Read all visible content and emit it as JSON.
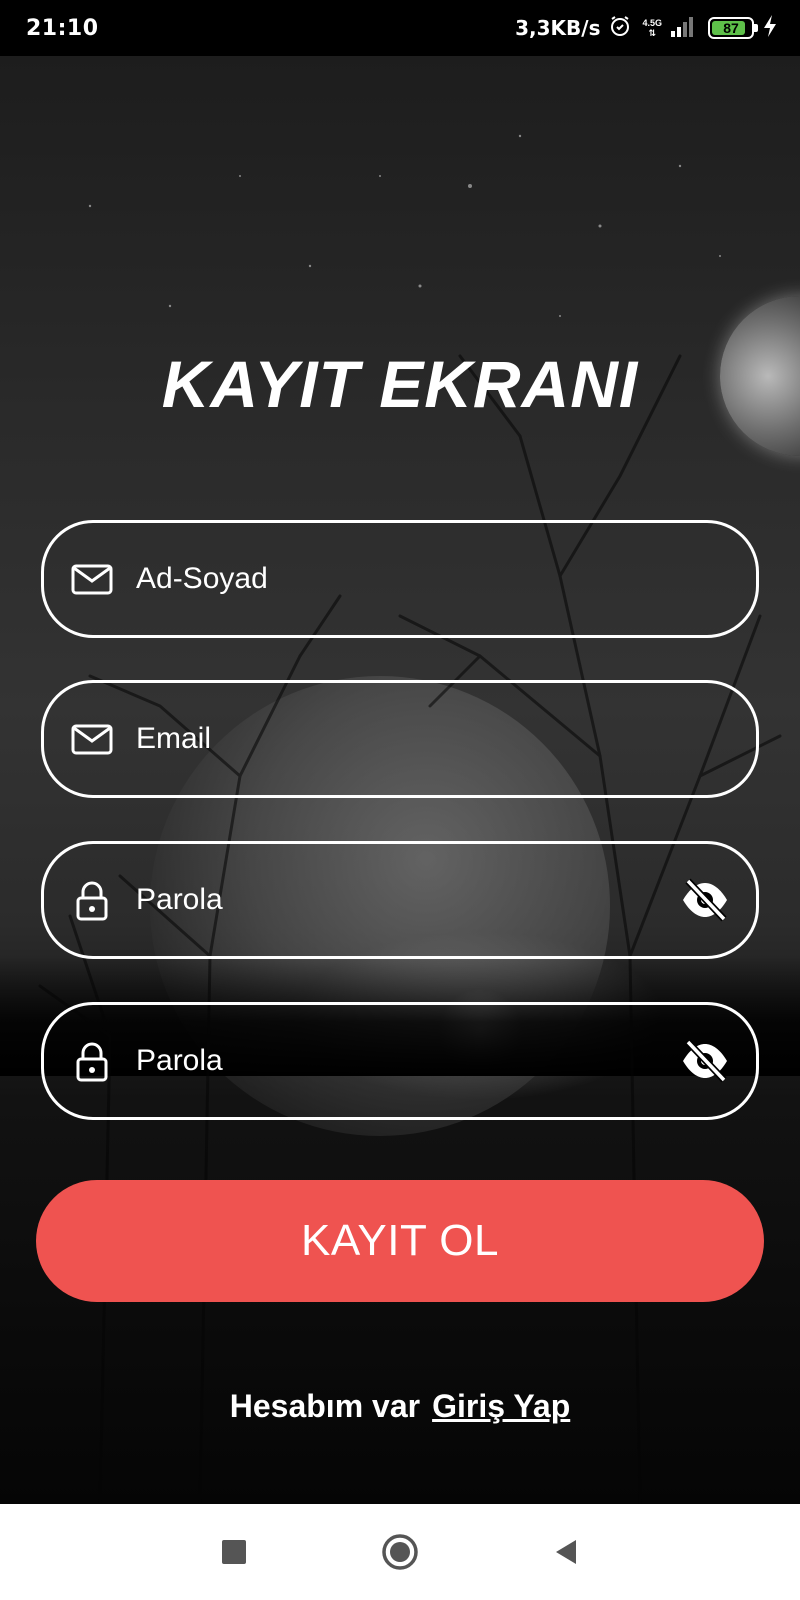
{
  "status_bar": {
    "time": "21:10",
    "net_speed": "3,3KB/s",
    "network_type": "4.5G",
    "battery_level": 87,
    "battery_text": "87"
  },
  "title": "KAYIT EKRANI",
  "fields": [
    {
      "icon": "mail-icon",
      "placeholder": "Ad-Soyad",
      "trailing_icon": null
    },
    {
      "icon": "mail-icon",
      "placeholder": "Email",
      "trailing_icon": null
    },
    {
      "icon": "lock-icon",
      "placeholder": "Parola",
      "trailing_icon": "eye-off-icon"
    },
    {
      "icon": "lock-icon",
      "placeholder": "Parola",
      "trailing_icon": "eye-off-icon"
    }
  ],
  "submit_label": "KAYIT OL",
  "footer": {
    "text": "Hesabım var",
    "link": "Giriş Yap"
  },
  "colors": {
    "accent": "#ef5350",
    "battery": "#5ec04a"
  },
  "nav": {
    "recents": "square-icon",
    "home": "circle-icon",
    "back": "triangle-back-icon"
  }
}
